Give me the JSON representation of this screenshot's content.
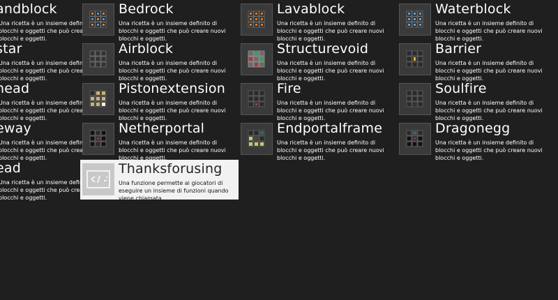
{
  "tiles": [
    {
      "title": "andblock",
      "desc": "Una ricetta è un insieme definito di blocchi e oggetti che può creare nuovi blocchi e oggetti.",
      "icon": "none"
    },
    {
      "title": "Bedrock",
      "desc": "Una ricetta è un insieme definito di blocchi e oggetti che può creare nuovi blocchi e oggetti.",
      "icon": "bedrock-recipe-icon"
    },
    {
      "title": "Lavablock",
      "desc": "Una ricetta è un insieme definito di blocchi e oggetti che può creare nuovi blocchi e oggetti.",
      "icon": "lava-recipe-icon"
    },
    {
      "title": "Waterblock",
      "desc": "Una ricetta è un insieme definito di blocchi e oggetti che può creare nuovi blocchi e oggetti.",
      "icon": "water-recipe-icon"
    },
    {
      "title": "star",
      "desc": "Una ricetta è un insieme definito di blocchi e oggetti che può creare nuovi blocchi e oggetti.",
      "icon": "none"
    },
    {
      "title": "Airblock",
      "desc": "Una ricetta è un insieme definito di blocchi e oggetti che può creare nuovi blocchi e oggetti.",
      "icon": "empty-grid-icon"
    },
    {
      "title": "Structurevoid",
      "desc": "Una ricetta è un insieme definito di blocchi e oggetti che può creare nuovi blocchi e oggetti.",
      "icon": "structurevoid-recipe-icon"
    },
    {
      "title": "Barrier",
      "desc": "Una ricetta è un insieme definito di blocchi e oggetti che può creare nuovi blocchi e oggetti.",
      "icon": "barrier-recipe-icon"
    },
    {
      "title": "head",
      "desc": "Una ricetta è un insieme definito di blocchi e oggetti che può creare nuovi blocchi e oggetti.",
      "icon": "none"
    },
    {
      "title": "Pistonextension",
      "desc": "Una ricetta è un insieme definito di blocchi e oggetti che può creare nuovi blocchi e oggetti.",
      "icon": "piston-recipe-icon"
    },
    {
      "title": "Fire",
      "desc": "Una ricetta è un insieme definito di blocchi e oggetti che può creare nuovi blocchi e oggetti.",
      "icon": "fire-recipe-icon"
    },
    {
      "title": "Soulfire",
      "desc": "Una ricetta è un insieme definito di blocchi e oggetti che può creare nuovi blocchi e oggetti.",
      "icon": "soulfire-recipe-icon"
    },
    {
      "title": "eway",
      "desc": "Una ricetta è un insieme definito di blocchi e oggetti che può creare nuovi blocchi e oggetti.",
      "icon": "none"
    },
    {
      "title": "Netherportal",
      "desc": "Una ricetta è un insieme definito di blocchi e oggetti che può creare nuovi blocchi e oggetti.",
      "icon": "netherportal-recipe-icon"
    },
    {
      "title": "Endportalframe",
      "desc": "Una ricetta è un insieme definito di blocchi e oggetti che può creare nuovi blocchi e oggetti.",
      "icon": "endportal-recipe-icon"
    },
    {
      "title": "Dragonegg",
      "desc": "Una ricetta è un insieme definito di blocchi e oggetti che può creare nuovi blocchi e oggetti.",
      "icon": "dragonegg-recipe-icon"
    },
    {
      "title": "ead",
      "desc": "Una ricetta è un insieme definito di blocchi e oggetti che può creare nuovi blocchi e oggetti.",
      "icon": "none"
    },
    {
      "title": "Thanksforusing",
      "desc": "Una funzione permette ai giocatori di eseguire un insieme di funzioni quando viene chiamata.",
      "icon": "function-icon"
    }
  ],
  "colors": {
    "background": "#1f1f1f",
    "selected_tile": "#f2f2f2",
    "text": "#ffffff"
  }
}
